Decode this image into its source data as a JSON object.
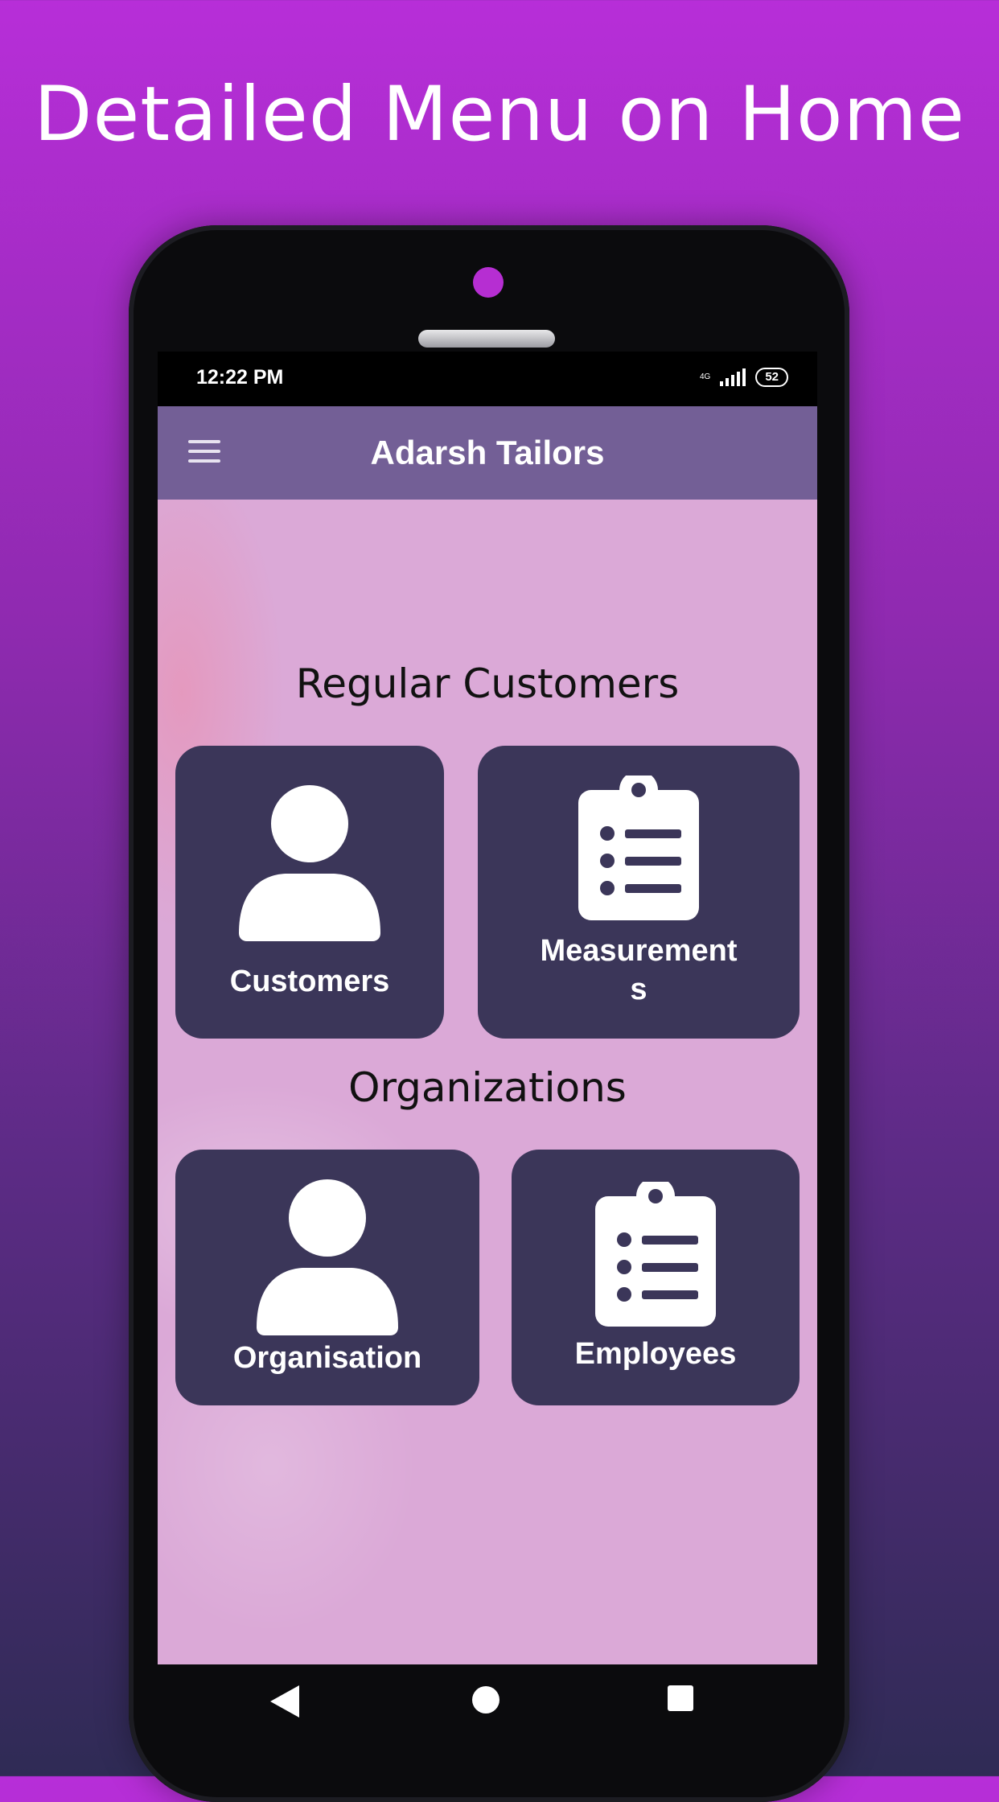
{
  "promo": {
    "headline": "Detailed Menu on Home"
  },
  "status_bar": {
    "time": "12:22 PM",
    "network": "4G",
    "battery": "52"
  },
  "app_bar": {
    "title": "Adarsh Tailors",
    "menu_icon": "hamburger-menu-icon"
  },
  "sections": [
    {
      "title": "Regular Customers",
      "cards": [
        {
          "label": "Customers",
          "icon": "person-icon"
        },
        {
          "label": "Measurement\ns",
          "icon": "clipboard-list-icon"
        }
      ]
    },
    {
      "title": "Organizations",
      "cards": [
        {
          "label": "Organisation",
          "icon": "person-icon"
        },
        {
          "label": "Employees",
          "icon": "clipboard-list-icon"
        }
      ]
    }
  ],
  "nav_bar": {
    "buttons": [
      "back-icon",
      "home-icon",
      "recents-icon"
    ]
  },
  "colors": {
    "appbar": "#735f96",
    "card": "#3b3659",
    "content_bg": "#dba9d7",
    "promo_bg_top": "#b72ed8"
  }
}
